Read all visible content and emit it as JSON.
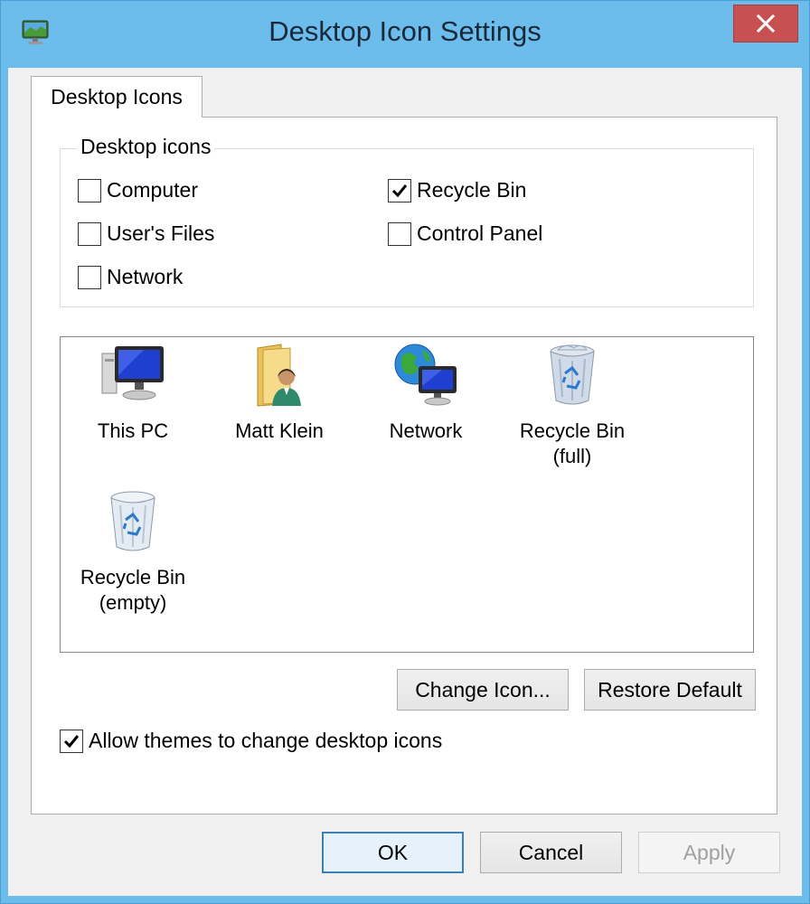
{
  "window": {
    "title": "Desktop Icon Settings",
    "close_symbol": "✕",
    "app_icon": "desktop-settings-icon"
  },
  "tabs": [
    {
      "label": "Desktop Icons",
      "selected": true
    }
  ],
  "desktop_icons_group": {
    "label": "Desktop icons",
    "checkboxes": [
      {
        "label": "Computer",
        "checked": false
      },
      {
        "label": "Recycle Bin",
        "checked": true
      },
      {
        "label": "User's Files",
        "checked": false
      },
      {
        "label": "Control Panel",
        "checked": false
      },
      {
        "label": "Network",
        "checked": false
      }
    ]
  },
  "icon_list": [
    {
      "label": "This PC",
      "icon": "computer-icon"
    },
    {
      "label": "Matt Klein",
      "icon": "user-folder-icon"
    },
    {
      "label": "Network",
      "icon": "network-globe-icon"
    },
    {
      "label": "Recycle Bin\n(full)",
      "icon": "recycle-bin-full-icon"
    },
    {
      "label": "Recycle Bin\n(empty)",
      "icon": "recycle-bin-empty-icon"
    }
  ],
  "buttons": {
    "change_icon": "Change Icon...",
    "restore_default": "Restore Default",
    "ok": "OK",
    "cancel": "Cancel",
    "apply": "Apply"
  },
  "allow_themes": {
    "label": "Allow themes to change desktop icons",
    "checked": true
  },
  "colors": {
    "title_bar": "#6cbdec",
    "close_button": "#c75050",
    "selection_border": "#3c7fb1"
  }
}
